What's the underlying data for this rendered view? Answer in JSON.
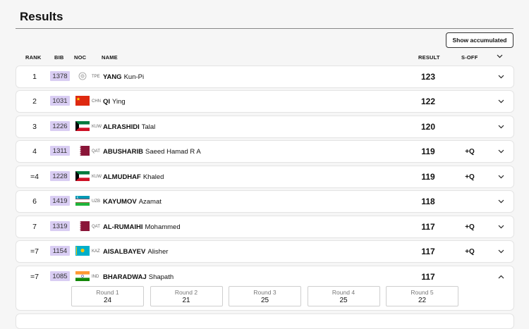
{
  "page": {
    "title": "Results",
    "accumulated_button": "Show accumulated"
  },
  "columns": {
    "rank": "RANK",
    "bib": "BIB",
    "noc": "NOC",
    "name": "NAME",
    "result": "RESULT",
    "soff": "S-OFF"
  },
  "rows": [
    {
      "rank": "1",
      "bib": "1378",
      "noc": "TPE",
      "surname": "YANG",
      "given": "Kun-Pi",
      "result": "123",
      "soff": "",
      "flag": "tpe"
    },
    {
      "rank": "2",
      "bib": "1031",
      "noc": "CHN",
      "surname": "QI",
      "given": "Ying",
      "result": "122",
      "soff": "",
      "flag": "chn"
    },
    {
      "rank": "3",
      "bib": "1226",
      "noc": "KUW",
      "surname": "ALRASHIDI",
      "given": "Talal",
      "result": "120",
      "soff": "",
      "flag": "kuw"
    },
    {
      "rank": "4",
      "bib": "1311",
      "noc": "QAT",
      "surname": "ABUSHARIB",
      "given": "Saeed Hamad R A",
      "result": "119",
      "soff": "+Q",
      "flag": "qat"
    },
    {
      "rank": "=4",
      "bib": "1228",
      "noc": "KUW",
      "surname": "ALMUDHAF",
      "given": "Khaled",
      "result": "119",
      "soff": "+Q",
      "flag": "kuw"
    },
    {
      "rank": "6",
      "bib": "1419",
      "noc": "UZB",
      "surname": "KAYUMOV",
      "given": "Azamat",
      "result": "118",
      "soff": "",
      "flag": "uzb"
    },
    {
      "rank": "7",
      "bib": "1319",
      "noc": "QAT",
      "surname": "AL-RUMAIHI",
      "given": "Mohammed",
      "result": "117",
      "soff": "+Q",
      "flag": "qat"
    },
    {
      "rank": "=7",
      "bib": "1154",
      "noc": "KAZ",
      "surname": "AISALBAYEV",
      "given": "Alisher",
      "result": "117",
      "soff": "+Q",
      "flag": "kaz"
    },
    {
      "rank": "=7",
      "bib": "1085",
      "noc": "IND",
      "surname": "BHARADWAJ",
      "given": "Shapath",
      "result": "117",
      "soff": "",
      "flag": "ind",
      "rounds": [
        {
          "label": "Round 1",
          "value": "24"
        },
        {
          "label": "Round 2",
          "value": "21"
        },
        {
          "label": "Round 3",
          "value": "25"
        },
        {
          "label": "Round 4",
          "value": "25"
        },
        {
          "label": "Round 5",
          "value": "22"
        }
      ]
    }
  ],
  "icons": {
    "collapsed": "chevron-down-icon",
    "expanded": "chevron-up-icon"
  },
  "colors": {
    "bib_bg": "#d9cdf3",
    "page_bg": "#f6f6f6"
  }
}
